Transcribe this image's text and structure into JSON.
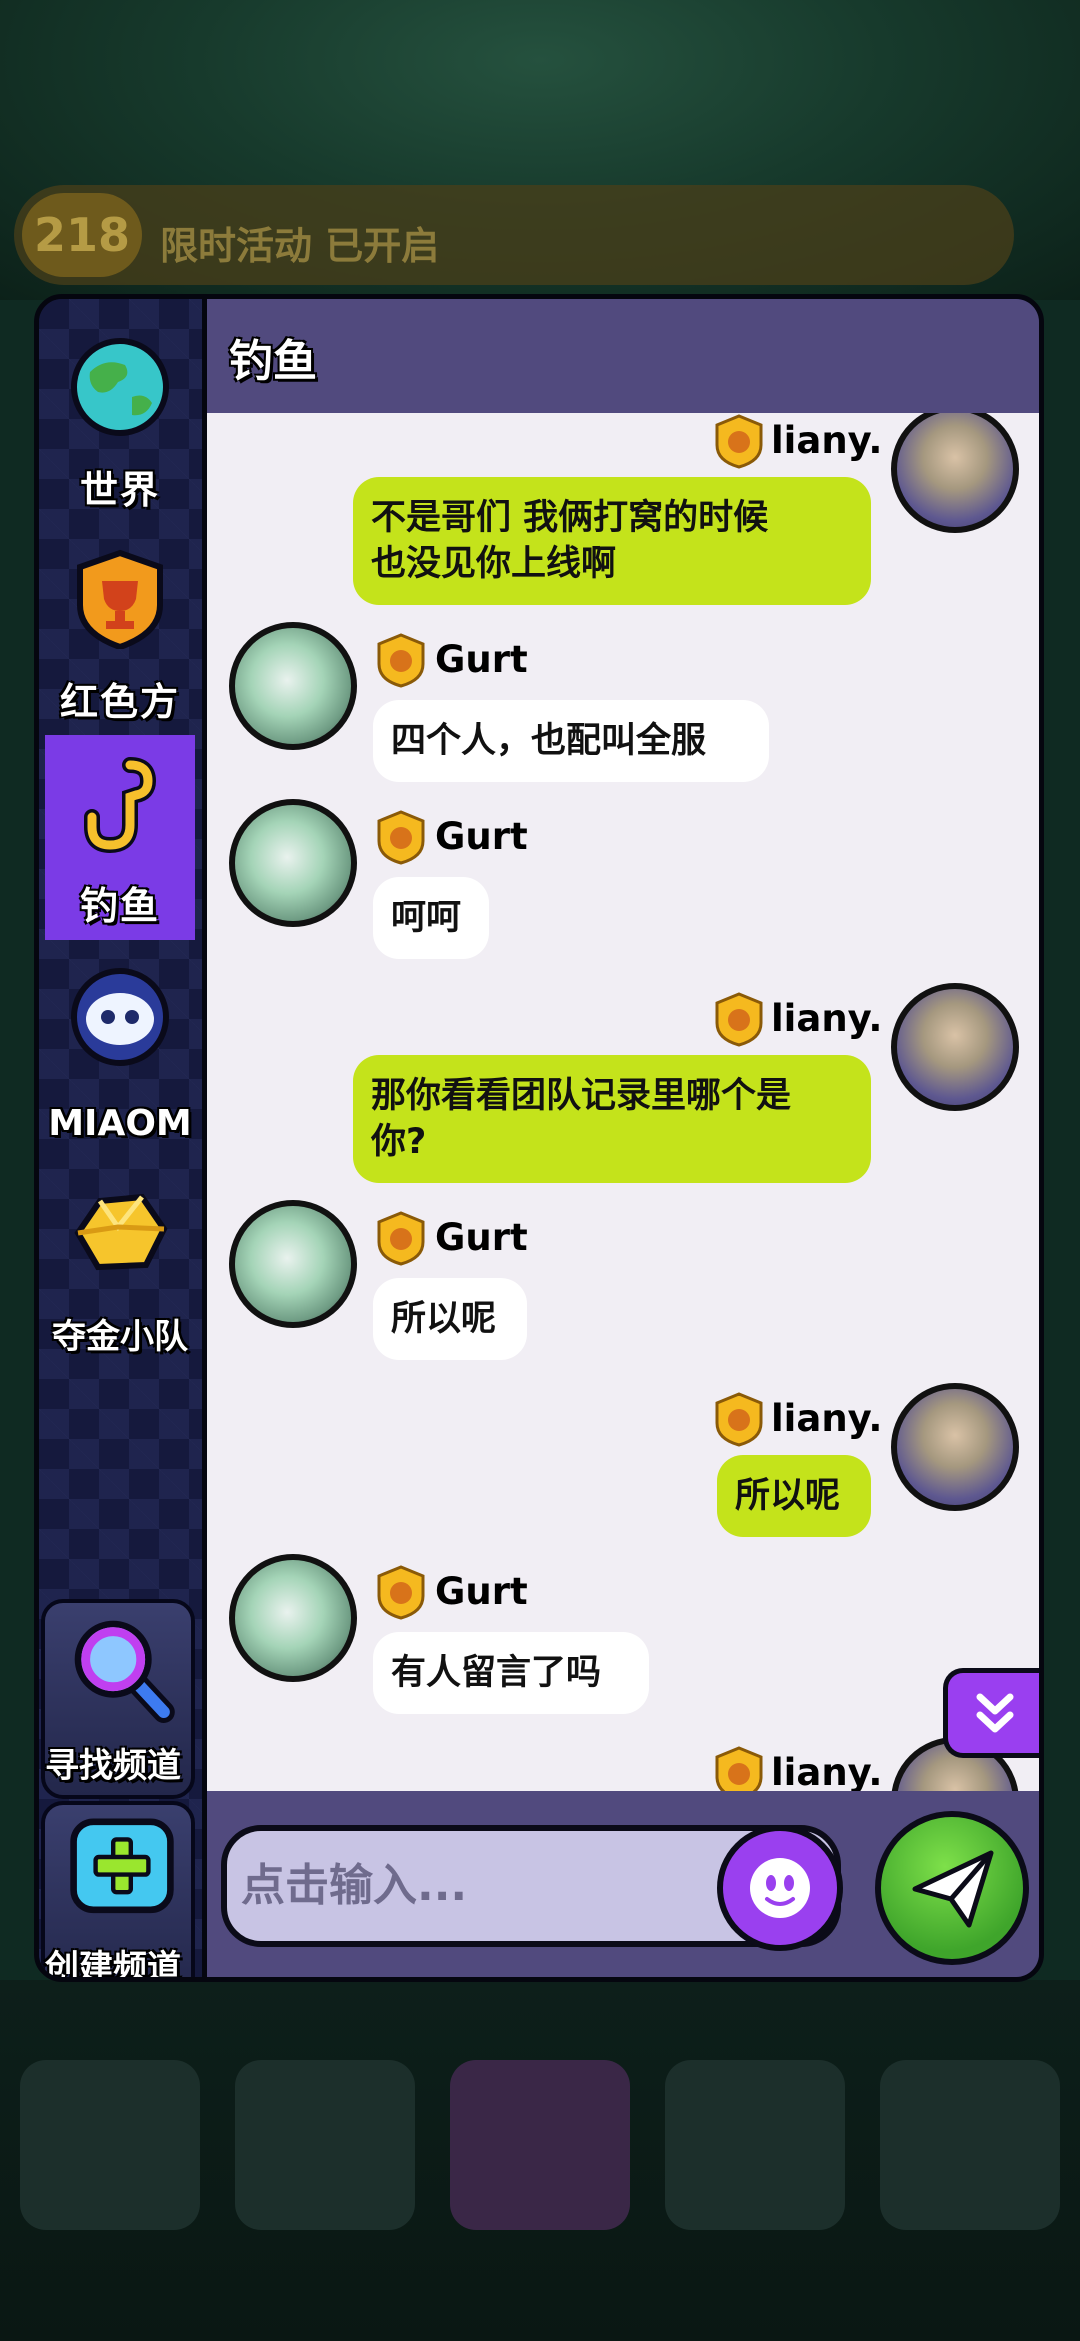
{
  "background": {
    "level_badge": "218",
    "level_text": "限时活动 已开启"
  },
  "sidebar": {
    "items": [
      {
        "label": "世界",
        "icon": "globe-icon"
      },
      {
        "label": "红色方",
        "icon": "trophy-shield-icon"
      },
      {
        "label": "钓鱼",
        "icon": "fishing-hook-icon",
        "active": true
      },
      {
        "label": "MIAOM",
        "icon": "guild-emblem-icon"
      },
      {
        "label": "夺金小队",
        "icon": "gold-nugget-icon"
      }
    ],
    "find_channel_label": "寻找频道",
    "create_channel_label": "创建频道"
  },
  "chat": {
    "title": "钓鱼",
    "messages": [
      {
        "sender": "liany.",
        "text_lines": [
          "不是哥们 我俩打窝的时候",
          "也没见你上线啊"
        ],
        "side": "right"
      },
      {
        "sender": "Gurt",
        "text_lines": [
          "四个人，也配叫全服"
        ],
        "side": "left"
      },
      {
        "sender": "Gurt",
        "text_lines": [
          "呵呵"
        ],
        "side": "left"
      },
      {
        "sender": "liany.",
        "text_lines": [
          "那你看看团队记录里哪个是",
          "你?"
        ],
        "side": "right"
      },
      {
        "sender": "Gurt",
        "text_lines": [
          "所以呢"
        ],
        "side": "left"
      },
      {
        "sender": "liany.",
        "text_lines": [
          "所以呢"
        ],
        "side": "right"
      },
      {
        "sender": "Gurt",
        "text_lines": [
          "有人留言了吗"
        ],
        "side": "left"
      },
      {
        "sender": "liany.",
        "text_lines": [],
        "side": "right"
      }
    ]
  },
  "input": {
    "placeholder": "点击输入..."
  },
  "colors": {
    "accent_purple": "#7b3be6",
    "bubble_green": "#c4e31b",
    "header": "#514a7e",
    "send_green": "#3fa52b"
  }
}
